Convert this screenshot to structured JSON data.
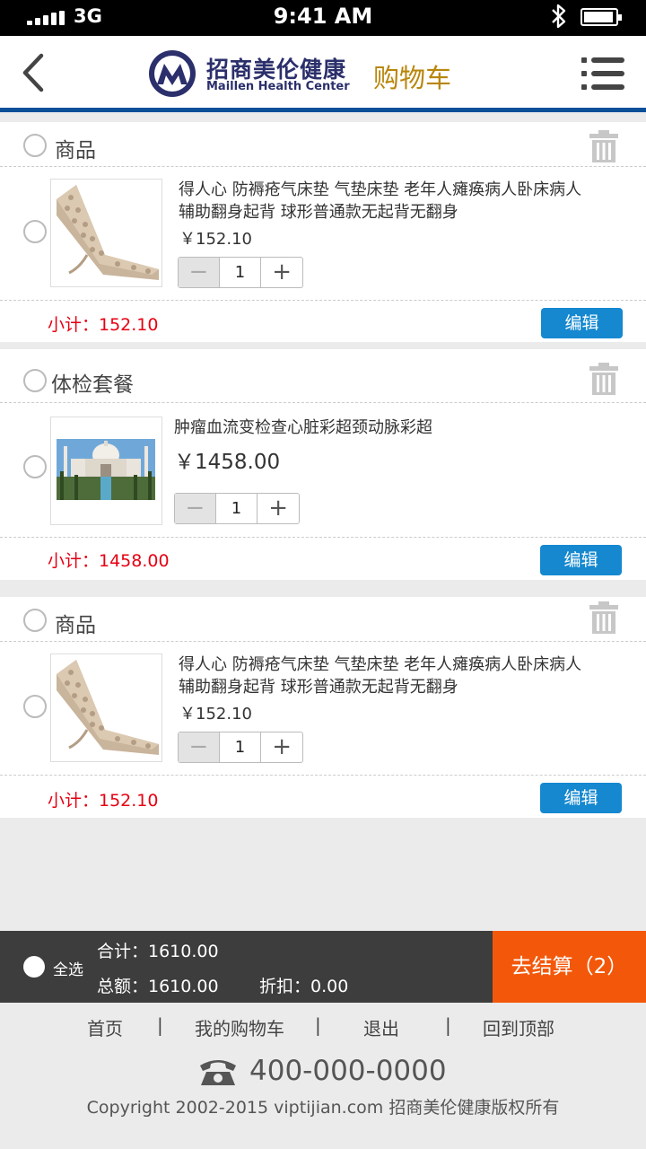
{
  "status": {
    "carrier": "3G",
    "time": "9:41 AM"
  },
  "header": {
    "brand_cn": "招商美伦健康",
    "brand_en": "Maillen Health Center",
    "title": "购物车"
  },
  "groups": [
    {
      "title": "商品",
      "item": {
        "name_line1": "得人心 防褥疮气床垫 气垫床垫 老年人瘫痪病人卧床病人",
        "name_line2": "辅助翻身起背 球形普通款无起背无翻身",
        "price": "￥152.10",
        "qty": "1"
      },
      "subtotal": "小计：152.10",
      "edit_label": "编辑"
    },
    {
      "title": "体检套餐",
      "item": {
        "name_line1": "肿瘤血流变检查心脏彩超颈动脉彩超",
        "name_line2": "",
        "price": "￥1458.00",
        "qty": "1"
      },
      "subtotal": "小计：1458.00",
      "edit_label": "编辑"
    },
    {
      "title": "商品",
      "item": {
        "name_line1": "得人心 防褥疮气床垫 气垫床垫 老年人瘫痪病人卧床病人",
        "name_line2": "辅助翻身起背 球形普通款无起背无翻身",
        "price": "￥152.10",
        "qty": "1"
      },
      "subtotal": "小计：152.10",
      "edit_label": "编辑"
    }
  ],
  "checkout": {
    "select_all": "全选",
    "total": "合计：1610.00",
    "amount": "总额：1610.00",
    "discount": "折扣：0.00",
    "pay_label": "去结算（2）"
  },
  "footer": {
    "nav": [
      "首页",
      "|",
      "我的购物车",
      "|",
      "退出",
      "|",
      "回到顶部"
    ],
    "phone": "400-000-0000",
    "copyright": "Copyright 2002-2015 viptijian.com  招商美伦健康版权所有"
  },
  "colors": {
    "accent_blue": "#1588d0",
    "header_rule": "#0a4f97",
    "price_red": "#e60012",
    "pay_orange": "#f3580a"
  }
}
